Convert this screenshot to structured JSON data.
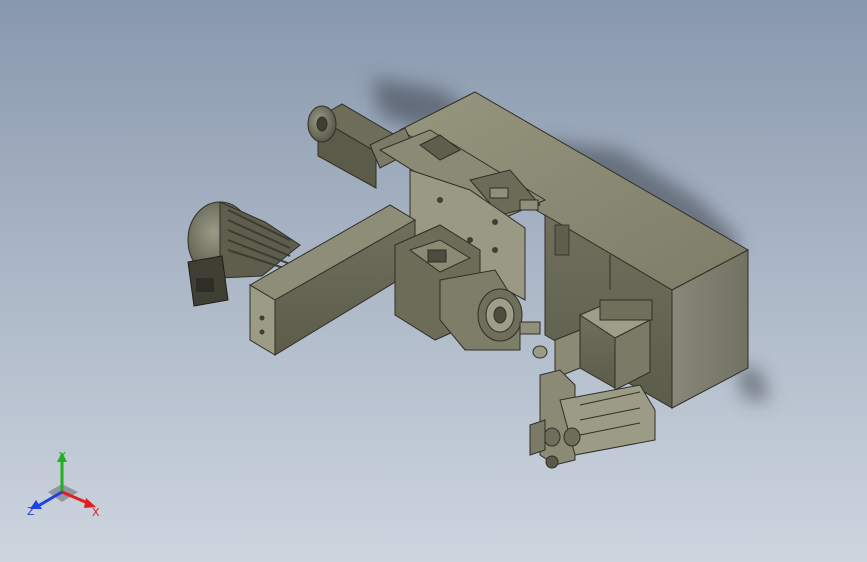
{
  "viewport": {
    "background_top": "#8898ad",
    "background_bottom": "#cdd5df",
    "part_color": "#7a7a66"
  },
  "triad": {
    "x_label": "X",
    "y_label": "Y",
    "z_label": "Z",
    "x_color": "#e02020",
    "y_color": "#20b020",
    "z_color": "#2040e0"
  }
}
